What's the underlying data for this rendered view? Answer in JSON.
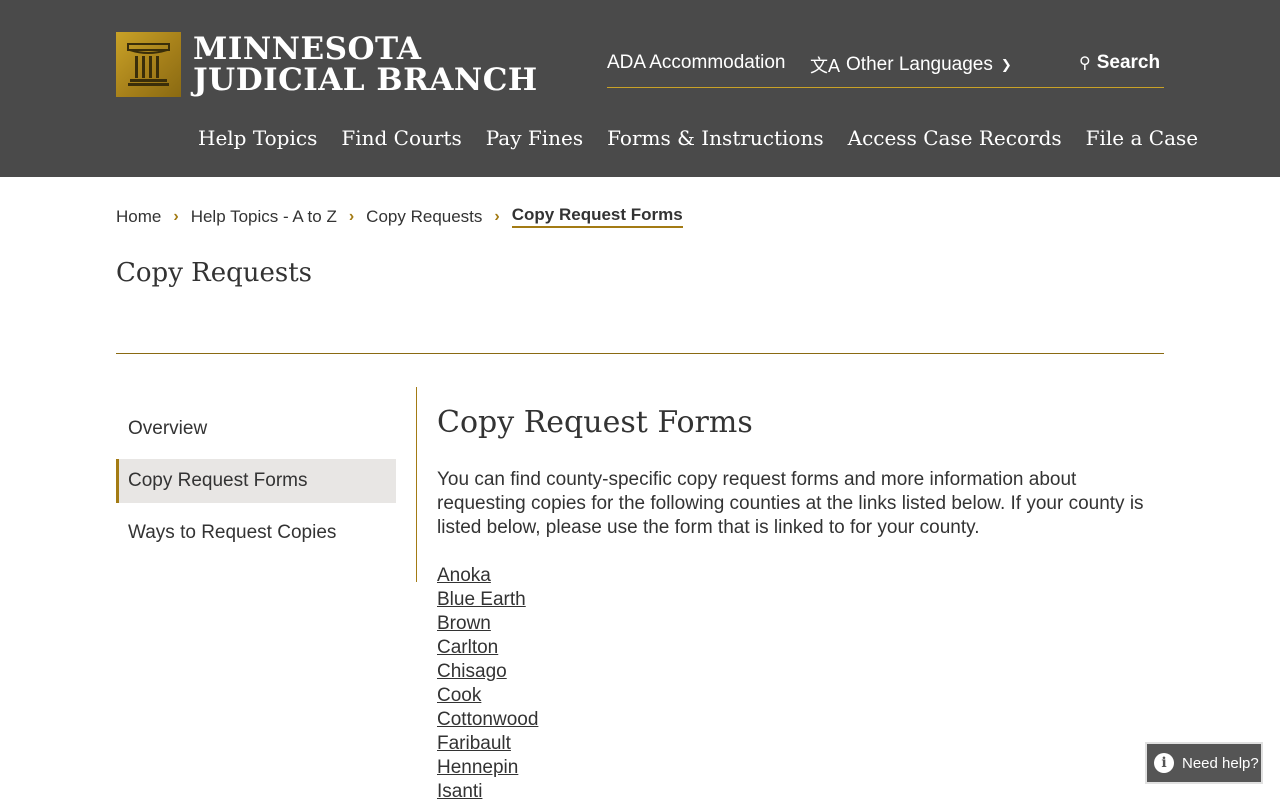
{
  "header": {
    "logo_line1": "MINNESOTA",
    "logo_line2": "JUDICIAL BRANCH",
    "utility": {
      "ada": "ADA Accommodation",
      "languages": "Other Languages",
      "search": "Search"
    },
    "nav": [
      "Help Topics",
      "Find Courts",
      "Pay Fines",
      "Forms & Instructions",
      "Access Case Records",
      "File a Case"
    ]
  },
  "breadcrumb": [
    "Home",
    "Help Topics - A to Z",
    "Copy Requests",
    "Copy Request Forms"
  ],
  "page_title": "Copy Requests",
  "sidebar": {
    "items": [
      "Overview",
      "Copy Request Forms",
      "Ways to Request Copies"
    ],
    "active_index": 1
  },
  "content": {
    "heading": "Copy Request Forms",
    "intro": "You can find county-specific copy request forms and more information about requesting copies for the following counties at the links listed below. If your county is listed below, please use the form that is linked to for your county.",
    "counties": [
      "Anoka",
      "Blue Earth",
      "Brown",
      "Carlton",
      "Chisago",
      "Cook",
      "Cottonwood",
      "Faribault",
      "Hennepin",
      "Isanti"
    ]
  },
  "help_widget": {
    "label": "Need help?"
  },
  "colors": {
    "header_bg": "#4a4a4a",
    "accent_gold": "#a37b14",
    "active_bg": "#e8e6e4"
  }
}
